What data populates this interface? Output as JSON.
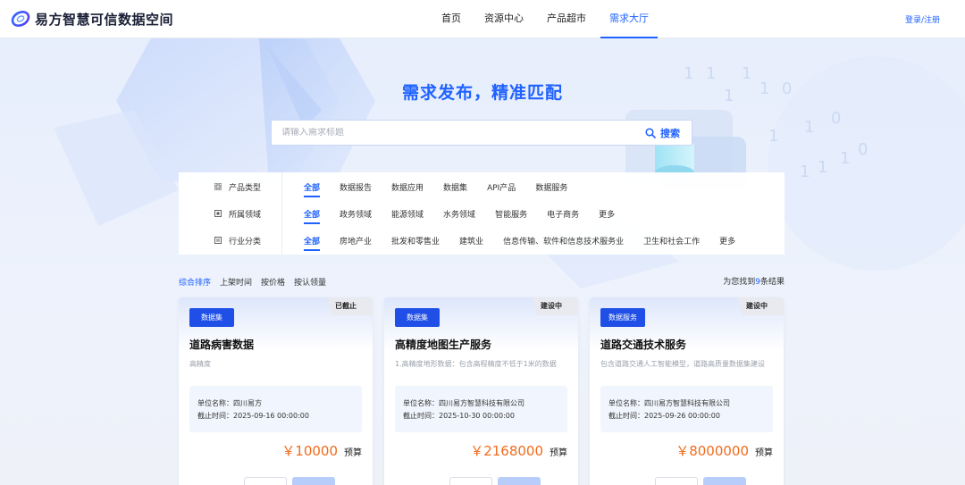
{
  "header": {
    "logo_text": "易方智慧可信数据空间",
    "nav": [
      {
        "label": "首页",
        "active": false
      },
      {
        "label": "资源中心",
        "active": false
      },
      {
        "label": "产品超市",
        "active": false
      },
      {
        "label": "需求大厅",
        "active": true
      }
    ],
    "login_label": "登录/注册"
  },
  "hero": {
    "title": "需求发布，精准匹配",
    "search_placeholder": "请输入需求标题",
    "search_button": "搜索"
  },
  "filters": [
    {
      "label": "产品类型",
      "icon": "grid-icon",
      "options": [
        "全部",
        "数据报告",
        "数据应用",
        "数据集",
        "API产品",
        "数据服务"
      ]
    },
    {
      "label": "所属领域",
      "icon": "square-icon",
      "options": [
        "全部",
        "政务领域",
        "能源领域",
        "水务领域",
        "智能服务",
        "电子商务",
        "更多"
      ]
    },
    {
      "label": "行业分类",
      "icon": "list-icon",
      "options": [
        "全部",
        "房地产业",
        "批发和零售业",
        "建筑业",
        "信息传输、软件和信息技术服务业",
        "卫生和社会工作",
        "更多"
      ]
    }
  ],
  "sort": {
    "items": [
      "综合排序",
      "上架时间",
      "按价格",
      "按认领量"
    ],
    "result_prefix": "为您找到",
    "result_count": "9",
    "result_suffix": "条结果"
  },
  "cards": [
    {
      "type_tag": "数据集",
      "status": "已截止",
      "title": "道路病害数据",
      "desc": "高精度",
      "org_label": "单位名称：",
      "org": "四川易方",
      "deadline_label": "截止时间：",
      "deadline": "2025-09-16 00:00:00",
      "price": "￥10000",
      "price_unit": "预算"
    },
    {
      "type_tag": "数据集",
      "status": "建设中",
      "title": "高精度地图生产服务",
      "desc": "1.高精度地形数据：包含高程精度不低于1米的数据",
      "org_label": "单位名称：",
      "org": "四川易方智慧科技有限公司",
      "deadline_label": "截止时间：",
      "deadline": "2025-10-30 00:00:00",
      "price": "￥2168000",
      "price_unit": "预算"
    },
    {
      "type_tag": "数据服务",
      "status": "建设中",
      "title": "道路交通技术服务",
      "desc": "包含道路交通人工智能模型，道路高质量数据集建设",
      "org_label": "单位名称：",
      "org": "四川易方智慧科技有限公司",
      "deadline_label": "截止时间：",
      "deadline": "2025-09-26 00:00:00",
      "price": "￥8000000",
      "price_unit": "预算"
    }
  ],
  "colors": {
    "accent": "#1f62ff",
    "tag_bg": "#1f4fe6",
    "price": "#f26b1d",
    "status_bg": "#e8eaf0"
  }
}
